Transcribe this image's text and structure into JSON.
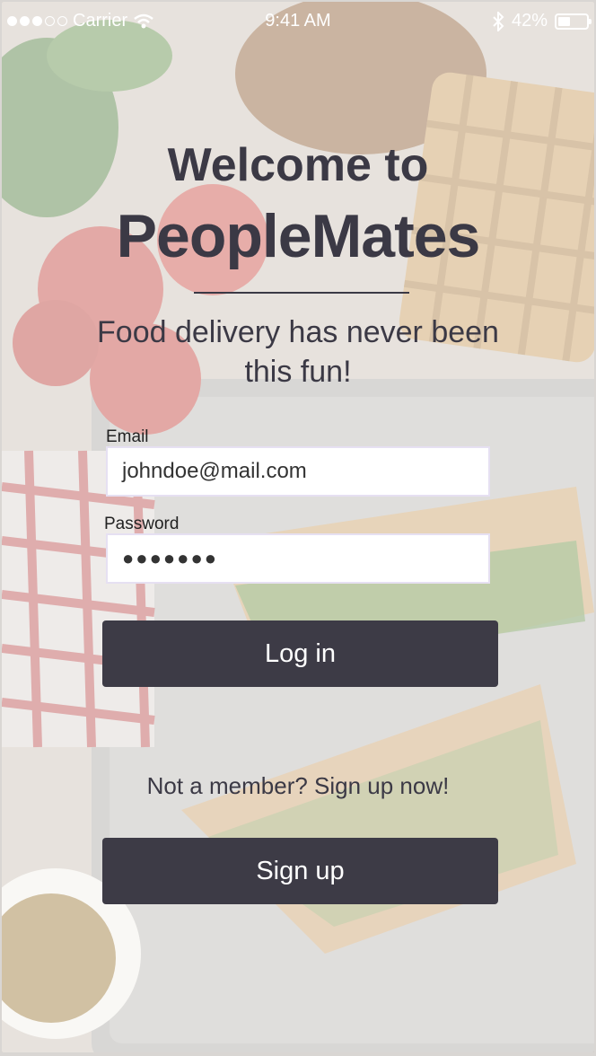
{
  "status_bar": {
    "carrier": "Carrier",
    "time": "9:41 AM",
    "battery_percent": "42%",
    "battery_level": 0.42,
    "signal_bars": 3,
    "icons": [
      "signal-dots",
      "wifi-icon",
      "bluetooth-icon",
      "battery-icon"
    ]
  },
  "welcome": {
    "line1": "Welcome to",
    "app_name": "PeopleMates",
    "tagline": "Food delivery has never been this fun!"
  },
  "login_form": {
    "email_label": "Email",
    "email_value": "johndoe@mail.com",
    "password_label": "Password",
    "password_value": "●●●●●●●",
    "login_button": "Log in"
  },
  "signup": {
    "prompt": "Not a member? Sign up now!",
    "button": "Sign up"
  },
  "colors": {
    "text_dark": "#3b3945",
    "button_bg": "#3d3b46",
    "button_text": "#ffffff",
    "field_border": "#e6e0f2"
  }
}
